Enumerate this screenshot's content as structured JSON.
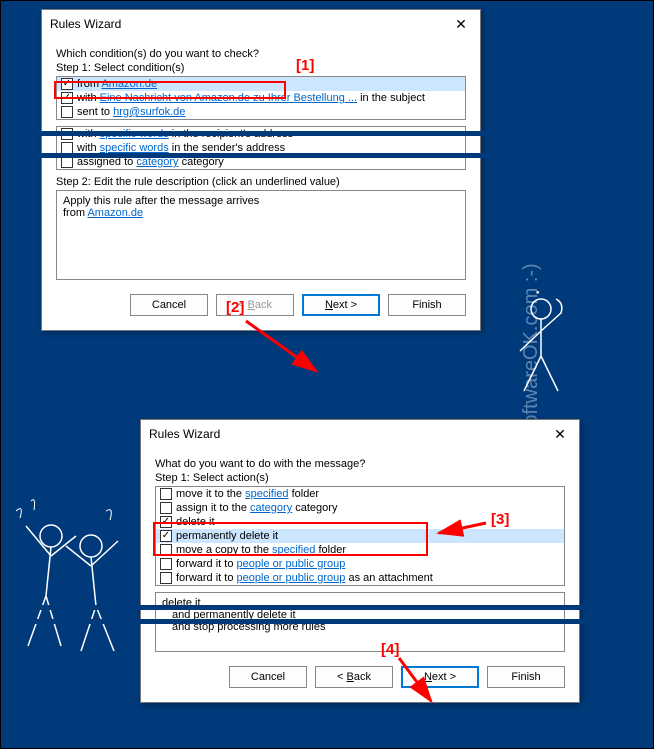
{
  "watermark": "www.SoftwareOK.com :-)",
  "dialog1": {
    "title": "Rules Wizard",
    "question": "Which condition(s) do you want to check?",
    "step": "Step 1: Select condition(s)",
    "cond": {
      "from_prefix": "from ",
      "from_link": "Amazon.de",
      "with_prefix": "with ",
      "subject_link": "Eine Nachricht von Amazon.de zu Ihrer Bestellung ...",
      "subject_suffix": " in the subject",
      "sent_prefix": "sent to ",
      "sent_link": "hrg@surfok.de",
      "spec_words": "specific words",
      "recip_suffix": " in the recipient's address",
      "sender_suffix": " in the sender's address",
      "assigned_prefix": "assigned to ",
      "category": "category",
      "category_suffix": " category"
    },
    "step2": "Step 2: Edit the rule description (click an underlined value)",
    "desc1": "Apply this rule after the message arrives",
    "desc2a": "from ",
    "desc2b": "Amazon.de",
    "buttons": {
      "cancel": "Cancel",
      "back": "< Back",
      "next": "Next >",
      "finish": "Finish"
    }
  },
  "dialog2": {
    "title": "Rules Wizard",
    "question": "What do you want to do with the message?",
    "step": "Step 1: Select action(s)",
    "act": {
      "move_prefix": "move it to the ",
      "specified": "specified",
      "folder_suffix": " folder",
      "assign_prefix": "assign it to the ",
      "category": "category",
      "category_suffix": " category",
      "delete": "delete it",
      "perm_delete": "permanently delete it",
      "movecopy_prefix": "move a copy to the ",
      "fwd_prefix": "forward it to ",
      "people": "people or public group",
      "attach_suffix": " as an attachment"
    },
    "desc_lines": {
      "l1": "delete it",
      "l2": "and permanently delete it",
      "l3": "and stop processing more rules"
    },
    "buttons": {
      "cancel": "Cancel",
      "back": "< Back",
      "next": "Next >",
      "finish": "Finish"
    }
  },
  "annotations": {
    "a1": "[1]",
    "a2": "[2]",
    "a3": "[3]",
    "a4": "[4]"
  }
}
